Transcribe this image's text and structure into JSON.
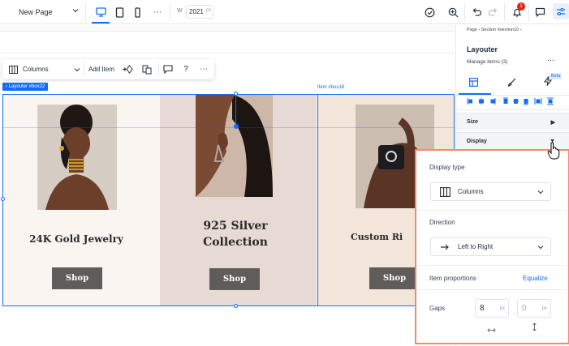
{
  "topbar": {
    "page_name": "New Page",
    "width_label": "W",
    "width_value": "2021",
    "width_unit": "px",
    "notification_count": "1"
  },
  "toolbar": {
    "layout_name": "Columns",
    "add_item_label": "Add Item"
  },
  "canvas": {
    "selection_label": "‹ Layouter #box22",
    "item_label": "Item #box18",
    "cards": [
      {
        "title_line1": "24K Gold Jewelry",
        "title_line2": "",
        "button": "Shop"
      },
      {
        "title_line1": "925 Silver",
        "title_line2": "Collection",
        "button": "Shop"
      },
      {
        "title_line1": "Custom Ri",
        "title_line2": "",
        "button": "Shop"
      }
    ]
  },
  "panel": {
    "breadcrumb": "Page  ›  Section #section10  ›",
    "title": "Layouter",
    "subtitle": "Manage items (3)",
    "beta_badge": "Beta",
    "sections": [
      {
        "label": "Size"
      },
      {
        "label": "Display"
      }
    ]
  },
  "display_settings": {
    "display_type_label": "Display type",
    "display_type_value": "Columns",
    "direction_label": "Direction",
    "direction_value": "Left to Right",
    "item_proportions_label": "Item proportions",
    "equalize_label": "Equalize",
    "gaps_label": "Gaps",
    "gap_horizontal": "8",
    "gap_vertical": "0",
    "gap_unit": "px"
  },
  "colors": {
    "accent": "#116dff",
    "callout_border": "#f28b6c",
    "card1_bg": "#fbf5f1",
    "card2_bg": "#e7d9d4",
    "card3_bg": "#f3e5d9",
    "shop_button": "#5f5c59"
  }
}
